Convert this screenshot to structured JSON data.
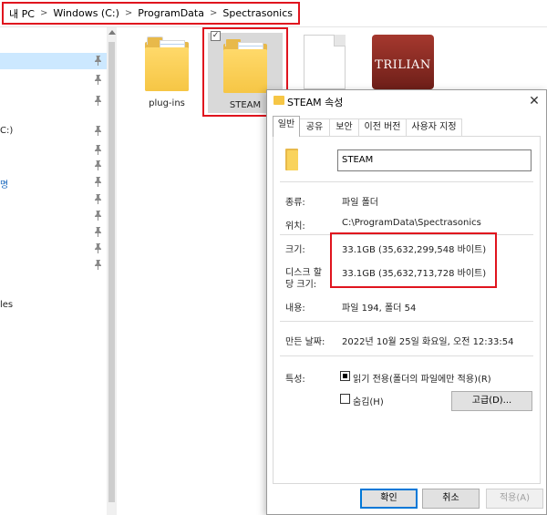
{
  "breadcrumb": {
    "items": [
      "내 PC",
      "Windows (C:)",
      "ProgramData",
      "Spectrasonics"
    ],
    "separator": ">"
  },
  "nav": {
    "scroll_up_icon": "chevron-up-icon",
    "items": [
      {
        "label": "",
        "pinned": true,
        "selected": true
      },
      {
        "label": "",
        "pinned": true
      },
      {
        "label": "",
        "pinned": true
      },
      {
        "label": "C:)",
        "pinned": true
      },
      {
        "label": "",
        "pinned": true
      },
      {
        "label": "",
        "pinned": true
      },
      {
        "label": "명",
        "pinned": true
      },
      {
        "label": "",
        "pinned": true
      },
      {
        "label": "",
        "pinned": true
      },
      {
        "label": "",
        "pinned": true
      },
      {
        "label": "",
        "pinned": true
      },
      {
        "label": "",
        "pinned": true
      },
      {
        "label": "les",
        "pinned": false
      }
    ]
  },
  "files": {
    "items": [
      {
        "name": "plug-ins",
        "type": "folder"
      },
      {
        "name": "STEAM",
        "type": "folder",
        "selected": true,
        "checked": true
      },
      {
        "name": "",
        "type": "file"
      },
      {
        "name": "",
        "type": "app-icon",
        "icon_text": "TRILIAN"
      }
    ],
    "check_mark": "✓"
  },
  "dialog": {
    "title": "STEAM 속성",
    "close_glyph": "✕",
    "tabs": [
      "일반",
      "공유",
      "보안",
      "이전 버전",
      "사용자 지정"
    ],
    "active_tab": 0,
    "name": "STEAM",
    "rows": {
      "type_label": "종류:",
      "type_value": "파일 폴더",
      "location_label": "위치:",
      "location_value": "C:\\ProgramData\\Spectrasonics",
      "size_label": "크기:",
      "size_value": "33.1GB (35,632,299,548 바이트)",
      "disk_size_label_1": "디스크 할",
      "disk_size_label_2": "당 크기:",
      "disk_size_value": "33.1GB (35,632,713,728 바이트)",
      "contents_label": "내용:",
      "contents_value": "파일 194, 폴더 54",
      "created_label": "만든 날짜:",
      "created_value": "2022년 10월 25일 화요일, 오전 12:33:54",
      "attributes_label": "특성:",
      "readonly_label": "읽기 전용(폴더의 파일에만 적용)(R)",
      "readonly_state": "indeterminate",
      "hidden_label": "숨김(H)",
      "hidden_state": "unchecked",
      "advanced_button": "고급(D)..."
    },
    "buttons": {
      "ok": "확인",
      "cancel": "취소",
      "apply": "적용(A)"
    }
  },
  "colors": {
    "highlight_red": "#e0141e",
    "selection_blue": "#cce8ff",
    "folder_yellow": "#f6c645",
    "trilian_red": "#8b2a22"
  }
}
